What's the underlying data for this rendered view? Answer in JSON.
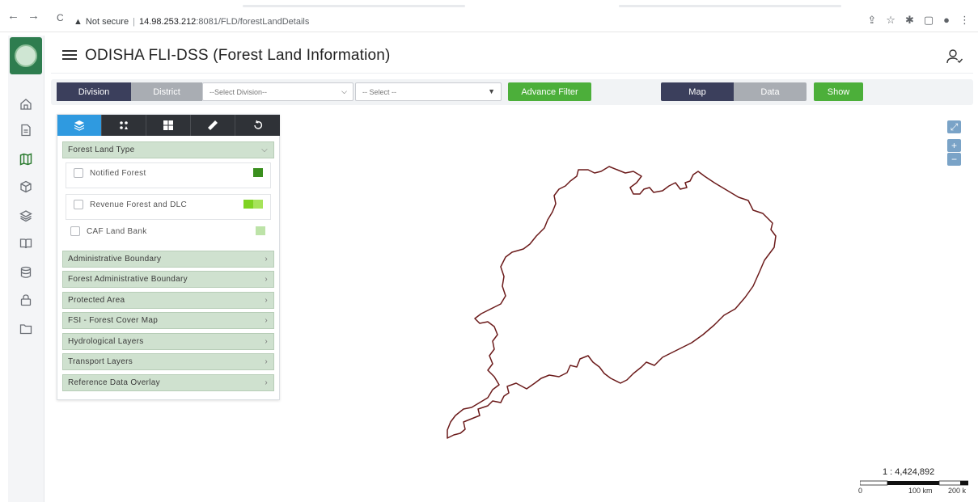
{
  "browser": {
    "back_icon": "←",
    "forward_icon": "→",
    "reload_icon": "C",
    "security_label": "Not secure",
    "url_host": "14.98.253.212",
    "url_path": ":8081/FLD/forestLandDetails"
  },
  "header": {
    "title": "ODISHA FLI-DSS (Forest Land Information)"
  },
  "sidebar": {
    "items": [
      {
        "icon": "home-icon"
      },
      {
        "icon": "document-icon"
      },
      {
        "icon": "map-icon",
        "active": true
      },
      {
        "icon": "cube-icon"
      },
      {
        "icon": "layers-icon"
      },
      {
        "icon": "book-icon"
      },
      {
        "icon": "database-icon"
      },
      {
        "icon": "lock-icon"
      },
      {
        "icon": "folder-icon"
      }
    ]
  },
  "toolbar": {
    "division_label": "Division",
    "district_label": "District",
    "division_select": "--Select Division--",
    "generic_select": "-- Select --",
    "advance_filter_label": "Advance Filter",
    "map_label": "Map",
    "data_label": "Data",
    "show_label": "Show"
  },
  "panel": {
    "tabs": [
      "layers-icon",
      "points-icon",
      "grid-icon",
      "ruler-icon",
      "reset-icon"
    ],
    "forest_land_type": "Forest Land Type",
    "layers": [
      {
        "label": "Notified Forest",
        "color": "#3a8f1e"
      },
      {
        "label": "Revenue Forest and DLC",
        "color": "#7ed321",
        "color2": "#a6e35a"
      },
      {
        "label": "CAF Land Bank",
        "color": "#bde3a8"
      }
    ],
    "sections": [
      "Administrative Boundary",
      "Forest Administrative Boundary",
      "Protected Area",
      "FSI - Forest Cover Map",
      "Hydrological Layers",
      "Transport Layers",
      "Reference Data Overlay"
    ]
  },
  "map": {
    "scale_ratio": "1 : 4,424,892",
    "scale_labels": [
      "0",
      "100 km",
      "200 k"
    ],
    "outline_color": "#6b1a1a"
  }
}
